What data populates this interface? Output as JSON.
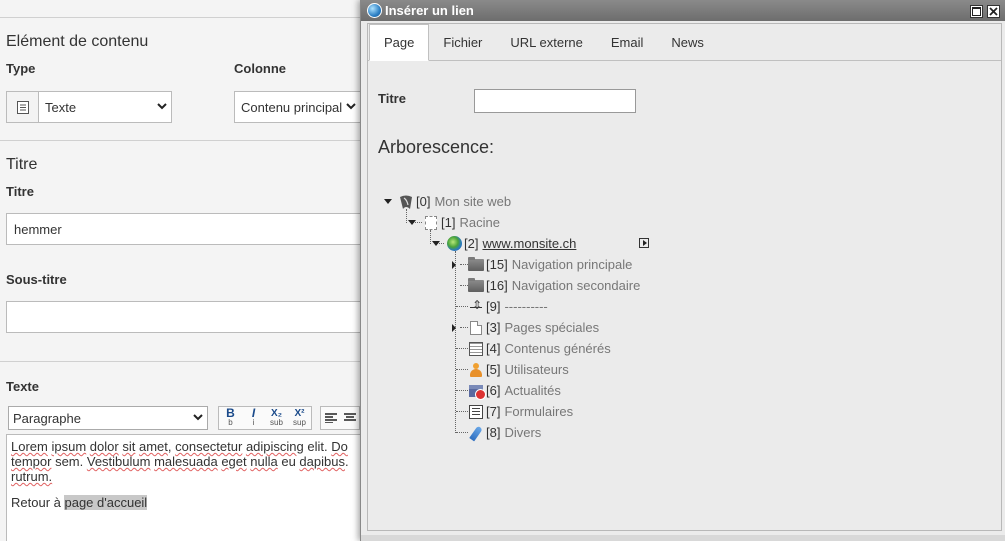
{
  "editor": {
    "section_title": "Elément de contenu",
    "type_label": "Type",
    "type_value": "Texte",
    "colonne_label": "Colonne",
    "colonne_value": "Contenu principal",
    "titre_section": "Titre",
    "titre_label": "Titre",
    "titre_value": "hemmer",
    "soustitre_label": "Sous-titre",
    "soustitre_value": "",
    "texte_label": "Texte",
    "format_value": "Paragraphe",
    "toolbar": {
      "bold": "B",
      "bold_sub": "b",
      "italic": "I",
      "italic_sub": "i",
      "sub": "X₂",
      "sub_sub": "sub",
      "sup": "X²",
      "sup_sub": "sup"
    },
    "rte": {
      "line1": [
        "Lorem",
        " ",
        "ipsum",
        " ",
        "dolor",
        " ",
        "sit",
        " ",
        "amet",
        ", ",
        "consectetur",
        " ",
        "adipiscing",
        " elit. ",
        "Do"
      ],
      "line2": [
        "tempor",
        " sem. ",
        "Vestibulum",
        " ",
        "malesuada",
        " ",
        "eget",
        " ",
        "nulla",
        " eu ",
        "dapibus",
        "."
      ],
      "line3": "rutrum.",
      "p2_prefix": "Retour à ",
      "p2_link": "page d'accueil"
    }
  },
  "dialog": {
    "title": "Insérer un lien",
    "tabs": [
      "Page",
      "Fichier",
      "URL externe",
      "Email",
      "News"
    ],
    "active_tab": "Page",
    "titre_label": "Titre",
    "titre_value": "",
    "arbo_title": "Arborescence:",
    "tree": [
      {
        "uid": "[0]",
        "title": "Mon site web",
        "icon": "typo3-root-icon"
      },
      {
        "uid": "[1]",
        "title": "Racine",
        "icon": "racine-page-icon"
      },
      {
        "uid": "[2]",
        "title": "www.monsite.ch",
        "icon": "globe-icon"
      },
      {
        "uid": "[15]",
        "title": "Navigation principale",
        "icon": "folder-icon"
      },
      {
        "uid": "[16]",
        "title": "Navigation secondaire",
        "icon": "folder-icon"
      },
      {
        "uid": "[9]",
        "title": "----------",
        "icon": "divider-icon"
      },
      {
        "uid": "[3]",
        "title": "Pages spéciales",
        "icon": "page-icon"
      },
      {
        "uid": "[4]",
        "title": "Contenus générés",
        "icon": "calendar-icon"
      },
      {
        "uid": "[5]",
        "title": "Utilisateurs",
        "icon": "user-icon"
      },
      {
        "uid": "[6]",
        "title": "Actualités",
        "icon": "news-icon"
      },
      {
        "uid": "[7]",
        "title": "Formulaires",
        "icon": "form-icon"
      },
      {
        "uid": "[8]",
        "title": "Divers",
        "icon": "feather-icon"
      }
    ]
  }
}
